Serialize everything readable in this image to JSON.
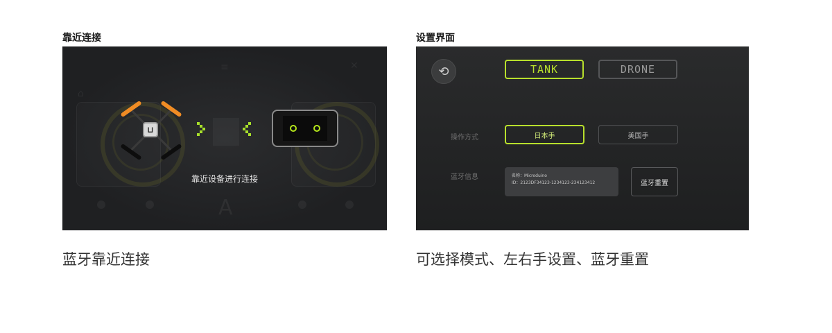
{
  "left_panel": {
    "title": "靠近连接",
    "caption": "蓝牙靠近连接",
    "connect_hint": "靠近设备进行连接",
    "drone_button_glyph": "⊔",
    "colors": {
      "accent": "#a7e02a",
      "propeller": "#f08c24"
    },
    "icons": [
      "drone-icon",
      "chevron-right-pixel-icon",
      "chevron-left-pixel-icon",
      "tank-face-icon"
    ]
  },
  "right_panel": {
    "title": "设置界面",
    "caption": "可选择模式、左右手设置、蓝牙重置",
    "back_icon": "back-arrow-icon",
    "back_glyph": "⟲",
    "modes": [
      {
        "label": "TANK",
        "active": true
      },
      {
        "label": "DRONE",
        "active": false
      }
    ],
    "operation_label": "操作方式",
    "hands": [
      {
        "label": "日本手",
        "active": true
      },
      {
        "label": "美国手",
        "active": false
      }
    ],
    "bluetooth_label": "蓝牙信息",
    "bluetooth_name": "名称：Microduino",
    "bluetooth_id": "ID：2123DF34123-1234123-234123412",
    "reset_label": "蓝牙重置",
    "colors": {
      "accent": "#b8e02c"
    }
  }
}
